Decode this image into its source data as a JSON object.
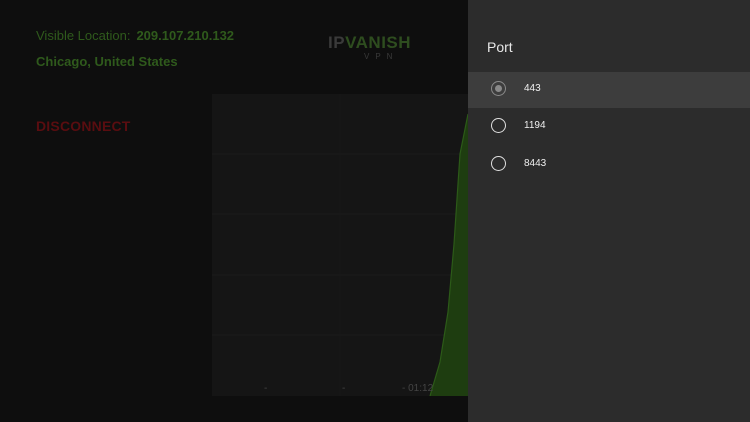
{
  "vpn": {
    "visible_location_label": "Visible Location:",
    "visible_ip": "209.107.210.132",
    "city": "Chicago, United States",
    "disconnect_label": "DISCONNECT",
    "logo": {
      "ip": "IP",
      "vanish": "VANISH",
      "sub": "VPN"
    },
    "graph": {
      "time_ticks": [
        "-",
        "-",
        "- 01:12"
      ]
    }
  },
  "port_dialog": {
    "title": "Port",
    "options": [
      {
        "label": "443",
        "selected": true
      },
      {
        "label": "1194",
        "selected": false
      },
      {
        "label": "8443",
        "selected": false
      }
    ]
  },
  "colors": {
    "accent_green": "#2f5a1c",
    "disconnect_red": "#5a0d10",
    "panel_bg": "#2c2c2c",
    "selected_row": "#3d3d3d"
  }
}
